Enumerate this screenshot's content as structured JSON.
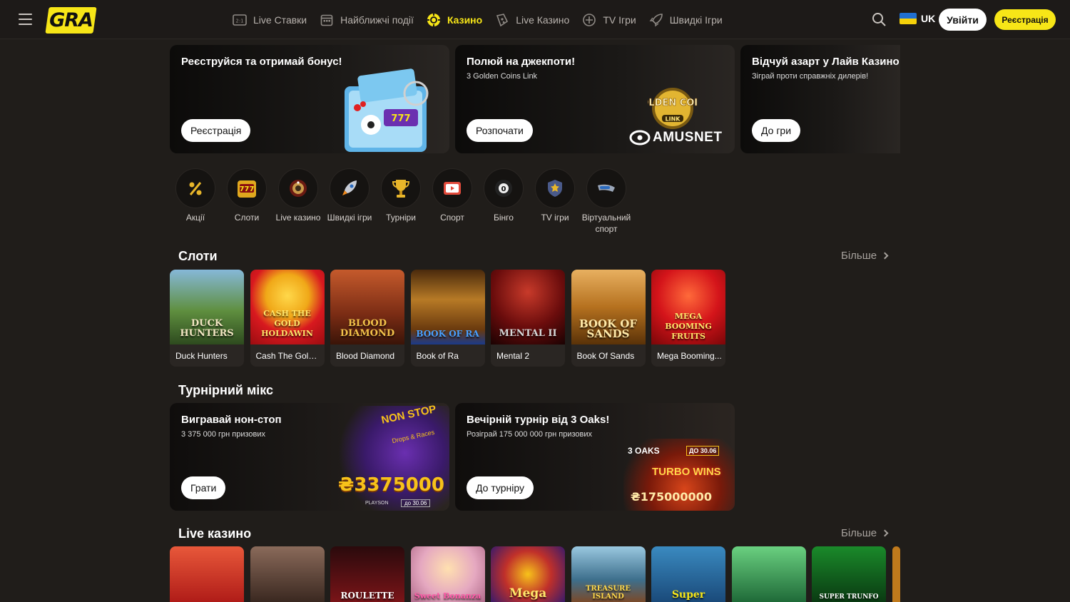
{
  "header": {
    "logo": "GRA",
    "nav": [
      {
        "label": "Live Ставки",
        "icon": "live-bets-icon",
        "active": false
      },
      {
        "label": "Найближчі події",
        "icon": "calendar-icon",
        "active": false
      },
      {
        "label": "Казино",
        "icon": "casino-chip-icon",
        "active": true
      },
      {
        "label": "Live Казино",
        "icon": "live-casino-icon",
        "active": false
      },
      {
        "label": "TV Ігри",
        "icon": "tv-games-icon",
        "active": false
      },
      {
        "label": "Швидкі Ігри",
        "icon": "rocket-icon",
        "active": false
      }
    ],
    "language": "UK",
    "login_label": "Увійти",
    "register_label": "Реєстрація"
  },
  "promos": [
    {
      "title": "Реєструйся та отримай бонус!",
      "subtitle": "",
      "button": "Реєстрація"
    },
    {
      "title": "Полюй на джекпоти!",
      "subtitle": "3 Golden Coins Link",
      "button": "Розпочати",
      "art_logo_top": "GOLDEN COINS",
      "art_logo_small": "LINK",
      "art_brand": "AMUSNET"
    },
    {
      "title": "Відчуй азарт у Лайв Казино",
      "subtitle": "Зіграй проти справжніх дилерів!",
      "button": "До гри"
    }
  ],
  "categories": [
    {
      "label": "Акції",
      "icon": "percent-icon"
    },
    {
      "label": "Слоти",
      "icon": "slot-machine-icon"
    },
    {
      "label": "Live казино",
      "icon": "roulette-icon"
    },
    {
      "label": "Швидкі ігри",
      "icon": "rocket-icon"
    },
    {
      "label": "Турніри",
      "icon": "trophy-icon"
    },
    {
      "label": "Спорт",
      "icon": "sport-tv-icon"
    },
    {
      "label": "Бінго",
      "icon": "bingo-ball-icon"
    },
    {
      "label": "TV ігри",
      "icon": "tv-shield-icon"
    },
    {
      "label": "Віртуальний спорт",
      "icon": "virtual-sport-icon"
    }
  ],
  "slots": {
    "title": "Слоти",
    "more": "Більше",
    "games": [
      {
        "name": "Duck Hunters",
        "art_text": "DUCK HUNTERS",
        "color": "#4f7a3a"
      },
      {
        "name": "Cash The Gold ...",
        "art_text": "CASH THE GOLD HOLDAWIN",
        "color": "#d8191f"
      },
      {
        "name": "Blood Diamond",
        "art_text": "BLOOD DIAMOND",
        "color": "#8a3a1c"
      },
      {
        "name": "Book of Ra",
        "art_text": "BOOK OF RA",
        "color": "#7a4a14"
      },
      {
        "name": "Mental 2",
        "art_text": "MENTAL II",
        "color": "#6a0c0c"
      },
      {
        "name": "Book Of Sands",
        "art_text": "BOOK OF SANDS",
        "color": "#b5711f"
      },
      {
        "name": "Mega Booming...",
        "art_text": "MEGA BOOMING FRUITS",
        "color": "#d4141a"
      }
    ]
  },
  "tournaments": {
    "title": "Турнірний мікс",
    "items": [
      {
        "title": "Вигравай нон-стоп",
        "subtitle": "3 375 000 грн призових",
        "button": "Грати",
        "art_big": "₴3375000",
        "art_top": "NON STOP",
        "art_mid": "Drops & Races",
        "art_brand": "PLAYSON",
        "art_date": "до 30.06"
      },
      {
        "title": "Вечірній турнір від 3 Oaks!",
        "subtitle": "Розіграй 175 000 000 грн призових",
        "button": "До турніру",
        "art_brand": "3 OAKS",
        "art_date": "ДО 30.06",
        "art_mid": "TURBO WINS",
        "art_big": "₴175000000"
      }
    ]
  },
  "live": {
    "title": "Live казино",
    "more": "Більше",
    "games": [
      {
        "art_text": "",
        "color": "#c0231d"
      },
      {
        "art_text": "",
        "color": "#5b3a2e"
      },
      {
        "art_text": "ROULETTE",
        "color": "#6c1418"
      },
      {
        "art_text": "Sweet Bonanza",
        "color": "#e5a8c0"
      },
      {
        "art_text": "Mega",
        "color": "#b02a2a"
      },
      {
        "art_text": "TREASURE ISLAND",
        "color": "#3d6f8c"
      },
      {
        "art_text": "Super",
        "color": "#2b6fa0"
      },
      {
        "art_text": "",
        "color": "#2f8f4a"
      },
      {
        "art_text": "SUPER TRUNFO",
        "color": "#1a6e2a"
      },
      {
        "art_text": "",
        "color": "#c07a1c"
      }
    ]
  },
  "colors": {
    "accent": "#f7e617",
    "background": "#201d1a",
    "header": "#1d1a18"
  }
}
